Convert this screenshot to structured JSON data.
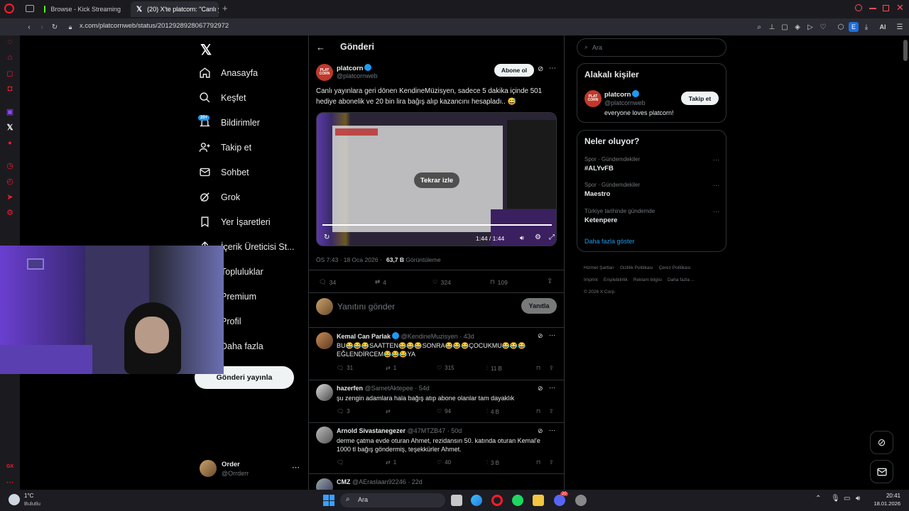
{
  "browser": {
    "tabs": [
      {
        "label": "Browse - Kick Streaming"
      },
      {
        "label": "(20) X'te platcorn: \"Canlı y"
      }
    ],
    "url": "x.com/platcornweb/status/2012928928067792972",
    "toolbar_ai": "AI",
    "profile_letter": "E"
  },
  "nav": {
    "items": [
      {
        "label": "Anasayfa"
      },
      {
        "label": "Keşfet"
      },
      {
        "label": "Bildirimler",
        "badge": "20+"
      },
      {
        "label": "Takip et"
      },
      {
        "label": "Sohbet"
      },
      {
        "label": "Grok"
      },
      {
        "label": "Yer İşaretleri"
      },
      {
        "label": "İçerik Üreticisi St..."
      },
      {
        "label": "Topluluklar"
      },
      {
        "label": "Premium"
      },
      {
        "label": "Profil"
      },
      {
        "label": "Daha fazla"
      }
    ],
    "post_button": "Gönderi yayınla",
    "account_name": "Order",
    "account_handle": "@Orrderr"
  },
  "post": {
    "header_title": "Gönderi",
    "author_name": "platcorn",
    "author_handle": "@platcornweb",
    "follow_button": "Abone ol",
    "avatar_text": "PLAT CORN",
    "text": "Canlı yayınlara geri dönen KendineMüzisyen, sadece 5 dakika içinde 501 hediye abonelik ve 20 bin lira bağış alıp kazancını hesapladı.. 😅",
    "video_replay": "Tekrar izle",
    "video_time": "1:44 / 1:44",
    "timestamp": "ÖS 7:43 · 18 Oca 2026 ·",
    "views_count": "63,7 B",
    "views_label": "Görüntüleme",
    "replies": "34",
    "reposts": "4",
    "likes": "324",
    "bookmarks": "109",
    "reply_placeholder": "Yanıtını gönder",
    "reply_button": "Yanıtla"
  },
  "replies": [
    {
      "name": "Kemal Can Parlak",
      "handle": "@KendineMuzisyen · 43d",
      "text": "BU😂😂😂SAATTEN😂😂😂SONRA😂😂😂ÇOCUKMU😂😂😂 EĞLENDİRCEM😂😂😂YA",
      "replies": "31",
      "reposts": "1",
      "likes": "315",
      "views": "11 B"
    },
    {
      "name": "hazerfen",
      "handle": "@SametAktepee · 54d",
      "text": "şu zengin adamlara hala bağış atıp abone olanlar tam dayaklık",
      "replies": "3",
      "reposts": "",
      "likes": "94",
      "views": "4 B"
    },
    {
      "name": "Arnold Sivastanegezer",
      "handle": "@47MTZB47 · 50d",
      "text": "derme çatma evde oturan Ahmet, rezidansın 50. katında oturan Kemal'e 1000 tl bağış göndermiş, teşekkürler Ahmet.",
      "replies": "",
      "reposts": "1",
      "likes": "40",
      "views": "3 B"
    },
    {
      "name": "CMZ",
      "handle": "@AEraslaan92246 · 22d",
      "text": "",
      "replies": "",
      "reposts": "",
      "likes": "",
      "views": ""
    }
  ],
  "right": {
    "search_placeholder": "Ara",
    "relevant_title": "Alakalı kişiler",
    "person_name": "platcorn",
    "person_handle": "@platcornweb",
    "person_bio": "everyone loves platcorn!",
    "person_follow": "Takip et",
    "trends_title": "Neler oluyor?",
    "trends": [
      {
        "sub": "Spor · Gündemdekiler",
        "title": "#ALYvFB"
      },
      {
        "sub": "Spor · Gündemdekiler",
        "title": "Maestro"
      },
      {
        "sub": "Türkiye tarihinde gündemde",
        "title": "Ketenpere"
      }
    ],
    "show_more": "Daha fazla göster",
    "footer": [
      "Hizmet Şartları",
      "Gizlilik Politikası",
      "Çerez Politikası",
      "Imprint",
      "Erişilebilirlik",
      "Reklam bilgisi",
      "Daha fazla ...",
      "© 2026 X Corp."
    ]
  },
  "taskbar": {
    "weather_temp": "1°C",
    "weather_desc": "Bulutlu",
    "search": "Ara",
    "time": "20:41",
    "date": "18.01.2026",
    "discord_badge": "20"
  },
  "colors": {
    "accent": "#1d9bf0",
    "opera_red": "#ff1b2d",
    "webcam_purple": "#6a3fd0"
  }
}
